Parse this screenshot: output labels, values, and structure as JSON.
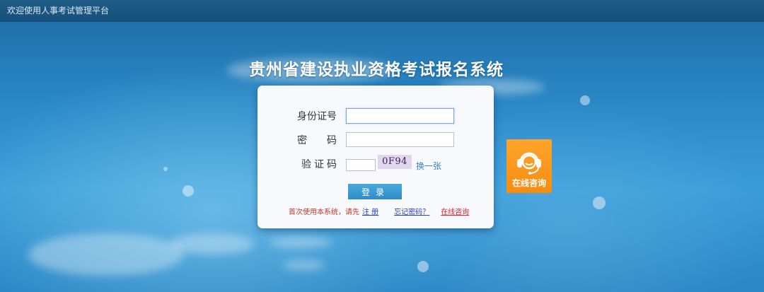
{
  "topbar": {
    "welcome": "欢迎使用人事考试管理平台"
  },
  "page": {
    "title": "贵州省建设执业资格考试报名系统"
  },
  "form": {
    "id_label": "身份证号",
    "id_value": "",
    "password_label": "密码",
    "password_value": "",
    "captcha_label": "验证码",
    "captcha_value": "",
    "captcha_code": "0F94",
    "refresh_label": "换一张",
    "login_label": "登录"
  },
  "footer": {
    "first_use_note": "首次使用本系统，请先",
    "register_label": "注 册",
    "forgot_label": "忘记密码？",
    "consult_label": "在线咨询"
  },
  "support": {
    "label": "在线咨询",
    "icon": "headset-icon",
    "color": "#f7931e"
  },
  "colors": {
    "background": "#2a88c6",
    "topbar": "#16507a",
    "login_button": "#3a97d0"
  }
}
